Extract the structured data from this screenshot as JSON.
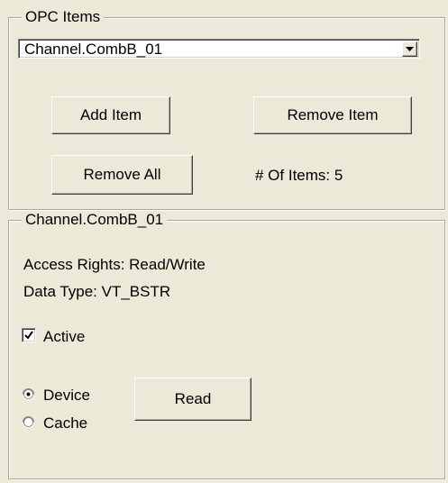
{
  "opc_items_group": {
    "title": "OPC Items",
    "selected_item": "Channel.CombB_01",
    "add_item_label": "Add Item",
    "remove_item_label": "Remove Item",
    "remove_all_label": "Remove All",
    "item_count_text": "# Of Items: 5"
  },
  "item_detail_group": {
    "title": "Channel.CombB_01",
    "access_rights": "Access Rights: Read/Write",
    "data_type": "Data Type: VT_BSTR",
    "active_label": "Active",
    "active_checked": true,
    "read_source": {
      "device_label": "Device",
      "cache_label": "Cache",
      "selected": "Device"
    },
    "read_label": "Read"
  },
  "colors": {
    "face": "#ece9d8",
    "border": "#aca899"
  }
}
